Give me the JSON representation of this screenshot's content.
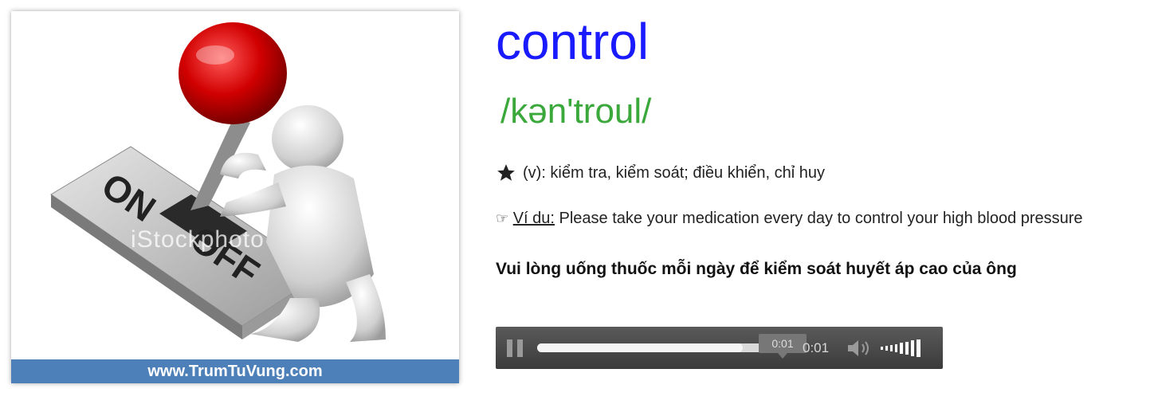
{
  "image_card": {
    "switch_labels": {
      "on": "ON",
      "off": "OFF"
    },
    "watermark": "iStockphoto",
    "caption": "www.TrumTuVung.com"
  },
  "entry": {
    "word": "control",
    "ipa": "/kən'troul/",
    "definition": "(v): kiểm tra, kiểm soát; điều khiển, chỉ huy",
    "example_label": "Ví du:",
    "example_text": " Please take your medication every day to control your high blood pressure",
    "translation": "Vui lòng uống thuốc mỗi ngày để kiểm soát huyết áp cao của ông"
  },
  "player": {
    "tooltip_time": "0:01",
    "current_time": "0:01",
    "progress": 0.81,
    "colors": {
      "bar": "#3b3b3b",
      "track": "#d9d9d9"
    }
  },
  "colors": {
    "word": "#1a1aff",
    "ipa": "#3aa83a",
    "caption_bg": "#4d7fb8"
  }
}
